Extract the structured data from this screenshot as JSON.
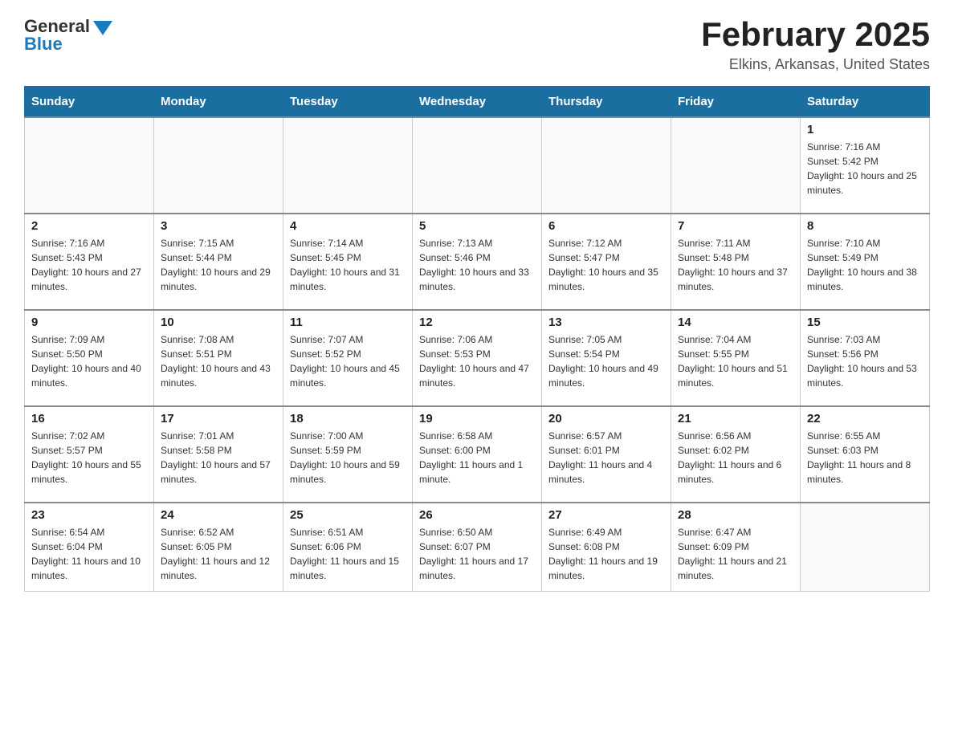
{
  "header": {
    "logo_general": "General",
    "logo_blue": "Blue",
    "title": "February 2025",
    "subtitle": "Elkins, Arkansas, United States"
  },
  "days_of_week": [
    "Sunday",
    "Monday",
    "Tuesday",
    "Wednesday",
    "Thursday",
    "Friday",
    "Saturday"
  ],
  "weeks": [
    [
      {
        "day": "",
        "info": ""
      },
      {
        "day": "",
        "info": ""
      },
      {
        "day": "",
        "info": ""
      },
      {
        "day": "",
        "info": ""
      },
      {
        "day": "",
        "info": ""
      },
      {
        "day": "",
        "info": ""
      },
      {
        "day": "1",
        "info": "Sunrise: 7:16 AM\nSunset: 5:42 PM\nDaylight: 10 hours and 25 minutes."
      }
    ],
    [
      {
        "day": "2",
        "info": "Sunrise: 7:16 AM\nSunset: 5:43 PM\nDaylight: 10 hours and 27 minutes."
      },
      {
        "day": "3",
        "info": "Sunrise: 7:15 AM\nSunset: 5:44 PM\nDaylight: 10 hours and 29 minutes."
      },
      {
        "day": "4",
        "info": "Sunrise: 7:14 AM\nSunset: 5:45 PM\nDaylight: 10 hours and 31 minutes."
      },
      {
        "day": "5",
        "info": "Sunrise: 7:13 AM\nSunset: 5:46 PM\nDaylight: 10 hours and 33 minutes."
      },
      {
        "day": "6",
        "info": "Sunrise: 7:12 AM\nSunset: 5:47 PM\nDaylight: 10 hours and 35 minutes."
      },
      {
        "day": "7",
        "info": "Sunrise: 7:11 AM\nSunset: 5:48 PM\nDaylight: 10 hours and 37 minutes."
      },
      {
        "day": "8",
        "info": "Sunrise: 7:10 AM\nSunset: 5:49 PM\nDaylight: 10 hours and 38 minutes."
      }
    ],
    [
      {
        "day": "9",
        "info": "Sunrise: 7:09 AM\nSunset: 5:50 PM\nDaylight: 10 hours and 40 minutes."
      },
      {
        "day": "10",
        "info": "Sunrise: 7:08 AM\nSunset: 5:51 PM\nDaylight: 10 hours and 43 minutes."
      },
      {
        "day": "11",
        "info": "Sunrise: 7:07 AM\nSunset: 5:52 PM\nDaylight: 10 hours and 45 minutes."
      },
      {
        "day": "12",
        "info": "Sunrise: 7:06 AM\nSunset: 5:53 PM\nDaylight: 10 hours and 47 minutes."
      },
      {
        "day": "13",
        "info": "Sunrise: 7:05 AM\nSunset: 5:54 PM\nDaylight: 10 hours and 49 minutes."
      },
      {
        "day": "14",
        "info": "Sunrise: 7:04 AM\nSunset: 5:55 PM\nDaylight: 10 hours and 51 minutes."
      },
      {
        "day": "15",
        "info": "Sunrise: 7:03 AM\nSunset: 5:56 PM\nDaylight: 10 hours and 53 minutes."
      }
    ],
    [
      {
        "day": "16",
        "info": "Sunrise: 7:02 AM\nSunset: 5:57 PM\nDaylight: 10 hours and 55 minutes."
      },
      {
        "day": "17",
        "info": "Sunrise: 7:01 AM\nSunset: 5:58 PM\nDaylight: 10 hours and 57 minutes."
      },
      {
        "day": "18",
        "info": "Sunrise: 7:00 AM\nSunset: 5:59 PM\nDaylight: 10 hours and 59 minutes."
      },
      {
        "day": "19",
        "info": "Sunrise: 6:58 AM\nSunset: 6:00 PM\nDaylight: 11 hours and 1 minute."
      },
      {
        "day": "20",
        "info": "Sunrise: 6:57 AM\nSunset: 6:01 PM\nDaylight: 11 hours and 4 minutes."
      },
      {
        "day": "21",
        "info": "Sunrise: 6:56 AM\nSunset: 6:02 PM\nDaylight: 11 hours and 6 minutes."
      },
      {
        "day": "22",
        "info": "Sunrise: 6:55 AM\nSunset: 6:03 PM\nDaylight: 11 hours and 8 minutes."
      }
    ],
    [
      {
        "day": "23",
        "info": "Sunrise: 6:54 AM\nSunset: 6:04 PM\nDaylight: 11 hours and 10 minutes."
      },
      {
        "day": "24",
        "info": "Sunrise: 6:52 AM\nSunset: 6:05 PM\nDaylight: 11 hours and 12 minutes."
      },
      {
        "day": "25",
        "info": "Sunrise: 6:51 AM\nSunset: 6:06 PM\nDaylight: 11 hours and 15 minutes."
      },
      {
        "day": "26",
        "info": "Sunrise: 6:50 AM\nSunset: 6:07 PM\nDaylight: 11 hours and 17 minutes."
      },
      {
        "day": "27",
        "info": "Sunrise: 6:49 AM\nSunset: 6:08 PM\nDaylight: 11 hours and 19 minutes."
      },
      {
        "day": "28",
        "info": "Sunrise: 6:47 AM\nSunset: 6:09 PM\nDaylight: 11 hours and 21 minutes."
      },
      {
        "day": "",
        "info": ""
      }
    ]
  ]
}
